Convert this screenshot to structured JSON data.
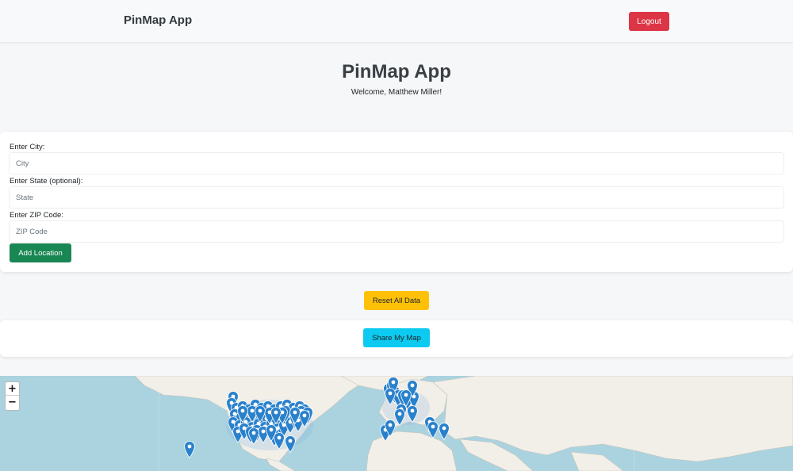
{
  "navbar": {
    "brand": "PinMap App",
    "logout_label": "Logout"
  },
  "header": {
    "title": "PinMap App",
    "welcome": "Welcome, Matthew Miller!"
  },
  "form": {
    "city_label": "Enter City:",
    "city_placeholder": "City",
    "city_value": "",
    "state_label": "Enter State (optional):",
    "state_placeholder": "State",
    "state_value": "",
    "zip_label": "Enter ZIP Code:",
    "zip_placeholder": "ZIP Code",
    "zip_value": "",
    "add_label": "Add Location"
  },
  "actions": {
    "reset_label": "Reset All Data",
    "share_label": "Share My Map"
  },
  "map": {
    "zoom_in": "+",
    "zoom_out": "−",
    "marker_icon": "map-pin-icon",
    "marker_color": "#2a81cb",
    "marker_count": 78,
    "water_color": "#aad3df",
    "land_color": "#f2efe9"
  },
  "colors": {
    "logout": "#dc3545",
    "add": "#198754",
    "reset": "#ffc107",
    "share": "#0dcaf0"
  }
}
